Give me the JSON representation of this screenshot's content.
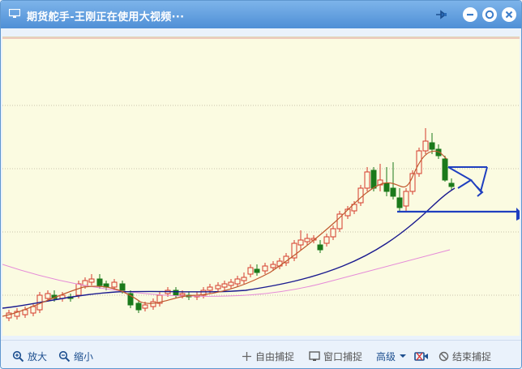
{
  "window": {
    "title": "期货舵手-王刚正在使用大视频···"
  },
  "toolbar": {
    "zoom_in_label": "放大",
    "zoom_out_label": "缩小",
    "free_capture_label": "自由捕捉",
    "window_capture_label": "窗口捕捉",
    "advanced_label": "高级",
    "stop_capture_label": "结束捕捉"
  },
  "icons": [
    "monitor-icon",
    "pin-icon",
    "minimize-icon",
    "settings-icon",
    "close-icon",
    "zoom-in-icon",
    "zoom-out-icon",
    "crosshair-icon",
    "window-icon",
    "caret-down-icon",
    "camera-icon",
    "stop-icon"
  ],
  "colors": {
    "title_bar": "#5a9ae0",
    "chart_background": "#fbfbe1",
    "up_candle": "#d43a2a",
    "down_candle": "#1b7a1b",
    "fast_ma": "#c0582e",
    "mid_ma": "#1a1a8f",
    "slow_ma": "#e58ad8",
    "annotation": "#1f3fbf"
  }
}
